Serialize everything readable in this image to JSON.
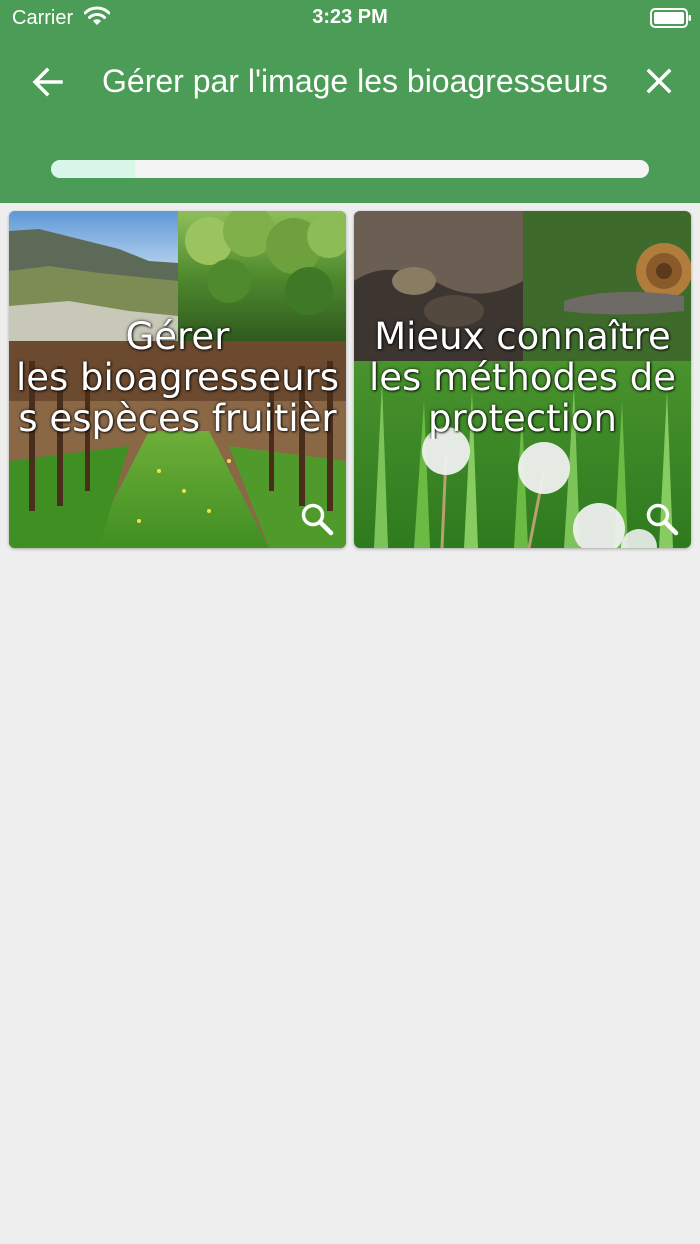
{
  "status_bar": {
    "carrier": "Carrier",
    "time": "3:23 PM",
    "wifi_icon": "wifi-icon",
    "battery_icon": "battery-icon"
  },
  "header": {
    "title": "Gérer par l'image les bioagresseurs",
    "back_icon": "arrow-left-icon",
    "close_icon": "close-icon",
    "progress_fraction": 0.14,
    "background_color": "#4b9c56",
    "progress_fill_color": "#d9f7e9"
  },
  "cards": [
    {
      "lines": [
        "Gérer",
        "les bioagresseurs",
        "s espèces fruitièr"
      ],
      "image": "orchard-and-mountains-photo",
      "icon": "search-icon"
    },
    {
      "lines": [
        "Mieux connaître",
        "les méthodes de",
        "protection"
      ],
      "image": "snail-and-dandelions-photo",
      "icon": "search-icon"
    }
  ]
}
